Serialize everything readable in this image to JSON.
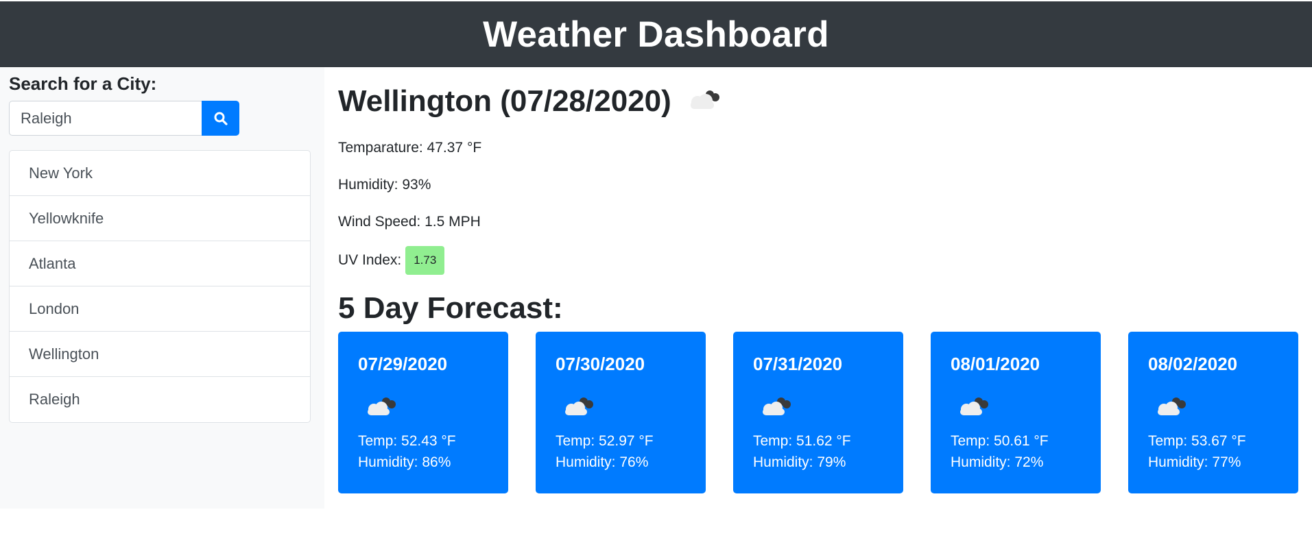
{
  "header": {
    "title": "Weather Dashboard"
  },
  "sidebar": {
    "search_label": "Search for a City:",
    "search_value": "Raleigh",
    "search_icon": "search-icon",
    "cities": [
      "New York",
      "Yellowknife",
      "Atlanta",
      "London",
      "Wellington",
      "Raleigh"
    ]
  },
  "current": {
    "title": "Wellington (07/28/2020)",
    "icon": "cloud-icon",
    "temperature": "Temparature: 47.37 °F",
    "humidity": "Humidity: 93%",
    "wind": "Wind Speed: 1.5 MPH",
    "uv_label": "UV Index:",
    "uv_value": "1.73",
    "uv_color": "#90ee90"
  },
  "forecast": {
    "title": "5 Day Forecast:",
    "days": [
      {
        "date": "07/29/2020",
        "icon": "cloud-icon",
        "temp": "Temp: 52.43 °F",
        "humidity": "Humidity: 86%"
      },
      {
        "date": "07/30/2020",
        "icon": "cloud-icon",
        "temp": "Temp: 52.97 °F",
        "humidity": "Humidity: 76%"
      },
      {
        "date": "07/31/2020",
        "icon": "cloud-icon",
        "temp": "Temp: 51.62 °F",
        "humidity": "Humidity: 79%"
      },
      {
        "date": "08/01/2020",
        "icon": "cloud-icon",
        "temp": "Temp: 50.61 °F",
        "humidity": "Humidity: 72%"
      },
      {
        "date": "08/02/2020",
        "icon": "cloud-icon",
        "temp": "Temp: 53.67 °F",
        "humidity": "Humidity: 77%"
      }
    ]
  },
  "colors": {
    "header_bg": "#343a40",
    "accent": "#007bff",
    "sidebar_bg": "#f8f9fa"
  }
}
